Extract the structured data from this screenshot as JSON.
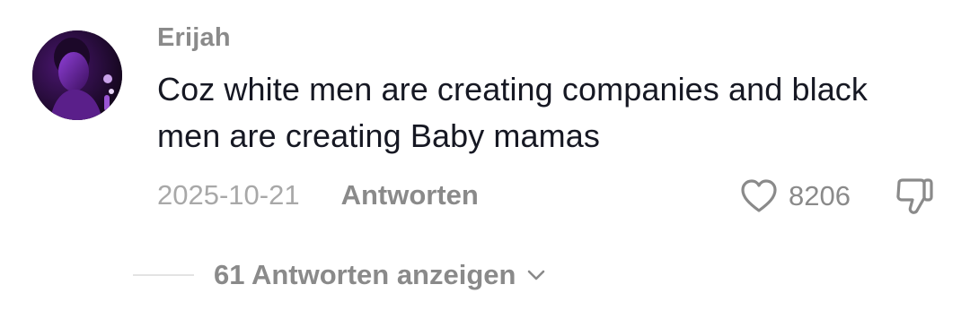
{
  "comment": {
    "username": "Erijah",
    "text": "Coz white men are creating companies and black men are creating Baby mamas",
    "date": "2025-10-21",
    "reply_label": "Antworten",
    "like_count": "8206",
    "view_replies_label": "61 Antworten anzeigen"
  },
  "icons": {
    "avatar": "avatar",
    "like": "heart-icon",
    "dislike": "thumbs-down-icon",
    "expand": "chevron-down-icon"
  },
  "colors": {
    "text_primary": "#161823",
    "text_secondary": "#8a8a8a",
    "avatar_accent": "#7a2bb8"
  }
}
